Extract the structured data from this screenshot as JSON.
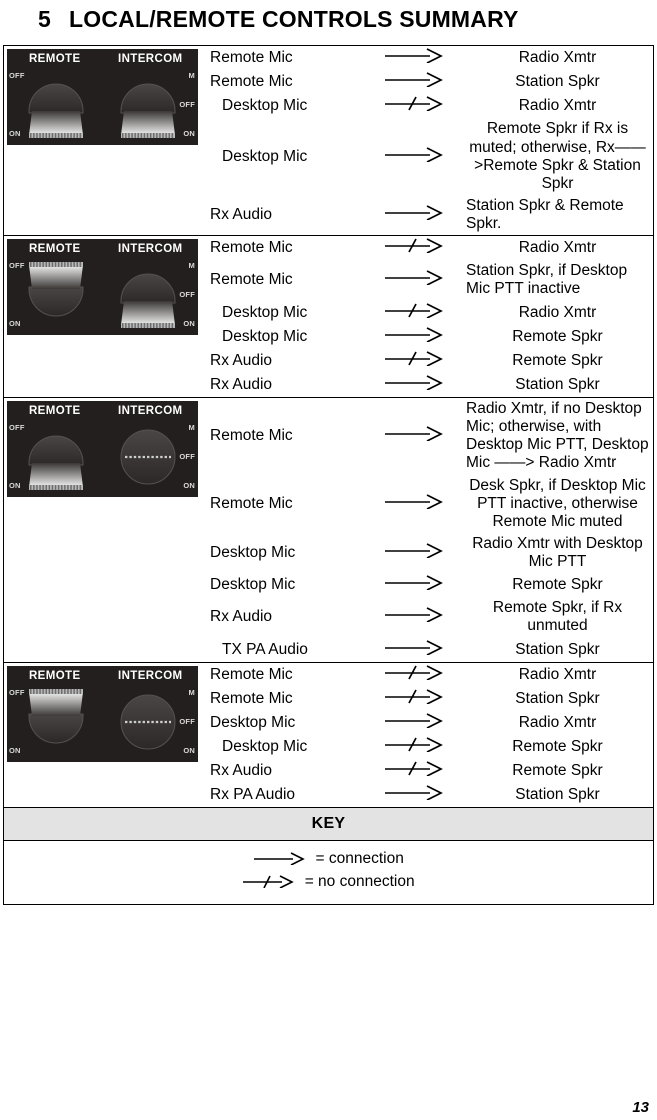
{
  "document": {
    "section_number": "5",
    "title": "LOCAL/REMOTE CONTROLS SUMMARY",
    "page_number": "13"
  },
  "panel": {
    "label_remote": "REMOTE",
    "label_intercom": "INTERCOM",
    "label_off": "OFF",
    "label_on": "ON",
    "label_m": "M",
    "background_color": "#231f1e",
    "text_color": "#ffffff"
  },
  "key": {
    "header": "KEY",
    "connection_label": "= connection",
    "no_connection_label": "= no connection"
  },
  "arrows": {
    "connected": "——>",
    "not_connected": "—/—>"
  },
  "sections": [
    {
      "name": "remote-on-intercom-on",
      "panel_state": {
        "remote": "ON",
        "intercom": "ON"
      },
      "rows": [
        {
          "source": "Remote Mic",
          "arrow": "connected",
          "dest": "Radio Xmtr",
          "src_align": "left",
          "dst_align": "center"
        },
        {
          "source": "Remote Mic",
          "arrow": "connected",
          "dest": "Station Spkr",
          "src_align": "left",
          "dst_align": "center"
        },
        {
          "source": "Desktop Mic",
          "arrow": "not_connected",
          "dest": "Radio Xmtr",
          "src_align": "indent",
          "dst_align": "center"
        },
        {
          "source": "Desktop Mic",
          "arrow": "connected",
          "dest": "Remote Spkr if Rx is muted; otherwise, Rx——>Remote Spkr & Station Spkr",
          "src_align": "indent",
          "dst_align": "center"
        },
        {
          "source": "Rx Audio",
          "arrow": "connected",
          "dest": "Station Spkr & Remote Spkr.",
          "src_align": "left",
          "dst_align": "left"
        }
      ]
    },
    {
      "name": "remote-off-intercom-on",
      "panel_state": {
        "remote": "OFF",
        "intercom": "ON"
      },
      "rows": [
        {
          "source": "Remote Mic",
          "arrow": "not_connected",
          "dest": "Radio Xmtr",
          "src_align": "left",
          "dst_align": "center"
        },
        {
          "source": "Remote Mic",
          "arrow": "connected",
          "dest": "Station Spkr, if Desktop Mic PTT inactive",
          "src_align": "left",
          "dst_align": "left"
        },
        {
          "source": "Desktop Mic",
          "arrow": "not_connected",
          "dest": "Radio Xmtr",
          "src_align": "indent",
          "dst_align": "center"
        },
        {
          "source": "Desktop Mic",
          "arrow": "connected",
          "dest": "Remote Spkr",
          "src_align": "indent",
          "dst_align": "center"
        },
        {
          "source": "Rx Audio",
          "arrow": "not_connected",
          "dest": "Remote Spkr",
          "src_align": "left",
          "dst_align": "center"
        },
        {
          "source": "Rx Audio",
          "arrow": "connected",
          "dest": "Station Spkr",
          "src_align": "left",
          "dst_align": "center"
        }
      ]
    },
    {
      "name": "remote-on-intercom-off",
      "panel_state": {
        "remote": "ON",
        "intercom": "OFF"
      },
      "rows": [
        {
          "source": "Remote Mic",
          "arrow": "connected",
          "dest": "Radio Xmtr, if no Desktop Mic; otherwise, with Desktop Mic PTT, Desktop Mic ——> Radio Xmtr",
          "src_align": "left",
          "dst_align": "left"
        },
        {
          "source": "Remote Mic",
          "arrow": "connected",
          "dest": "Desk Spkr, if Desktop Mic PTT inactive, otherwise Remote Mic muted",
          "src_align": "left",
          "dst_align": "center"
        },
        {
          "source": "Desktop Mic",
          "arrow": "connected",
          "dest": "Radio Xmtr with Desktop Mic PTT",
          "src_align": "left",
          "dst_align": "center"
        },
        {
          "source": "Desktop Mic",
          "arrow": "connected",
          "dest": "Remote Spkr",
          "src_align": "left",
          "dst_align": "center"
        },
        {
          "source": "Rx Audio",
          "arrow": "connected",
          "dest": "Remote Spkr, if Rx unmuted",
          "src_align": "left",
          "dst_align": "center"
        },
        {
          "source": "TX PA Audio",
          "arrow": "connected",
          "dest": "Station Spkr",
          "src_align": "indent",
          "dst_align": "center"
        }
      ]
    },
    {
      "name": "remote-off-intercom-off",
      "panel_state": {
        "remote": "OFF",
        "intercom": "OFF"
      },
      "rows": [
        {
          "source": "Remote Mic",
          "arrow": "not_connected",
          "dest": "Radio Xmtr",
          "src_align": "left",
          "dst_align": "center"
        },
        {
          "source": "Remote Mic",
          "arrow": "not_connected",
          "dest": "Station Spkr",
          "src_align": "left",
          "dst_align": "center"
        },
        {
          "source": "Desktop Mic",
          "arrow": "connected",
          "dest": "Radio Xmtr",
          "src_align": "left",
          "dst_align": "center"
        },
        {
          "source": "Desktop Mic",
          "arrow": "not_connected",
          "dest": "Remote Spkr",
          "src_align": "indent",
          "dst_align": "center"
        },
        {
          "source": "Rx Audio",
          "arrow": "not_connected",
          "dest": "Remote Spkr",
          "src_align": "left",
          "dst_align": "center"
        },
        {
          "source": "Rx PA Audio",
          "arrow": "connected",
          "dest": "Station Spkr",
          "src_align": "left",
          "dst_align": "center"
        }
      ]
    }
  ]
}
